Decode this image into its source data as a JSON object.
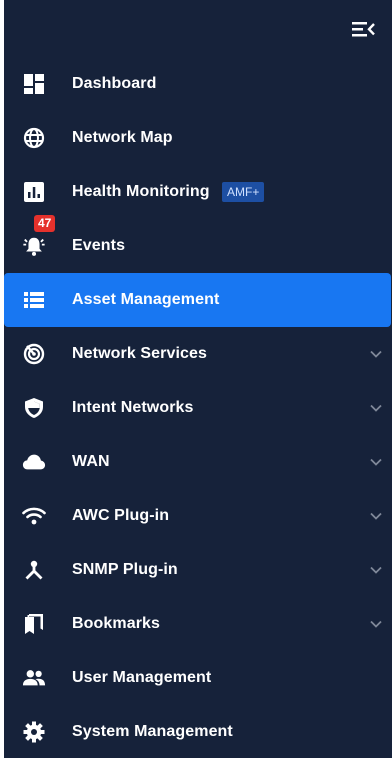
{
  "sidebar": {
    "items": [
      {
        "label": "Dashboard",
        "icon": "dashboard-icon"
      },
      {
        "label": "Network Map",
        "icon": "globe-icon"
      },
      {
        "label": "Health Monitoring",
        "icon": "bar-chart-icon",
        "tag": "AMF+"
      },
      {
        "label": "Events",
        "icon": "bell-alert-icon",
        "badge": "47"
      },
      {
        "label": "Asset Management",
        "icon": "list-icon",
        "active": true
      },
      {
        "label": "Network Services",
        "icon": "radar-icon",
        "expandable": true
      },
      {
        "label": "Intent Networks",
        "icon": "shield-icon",
        "expandable": true
      },
      {
        "label": "WAN",
        "icon": "cloud-icon",
        "expandable": true
      },
      {
        "label": "AWC Plug-in",
        "icon": "wifi-icon",
        "expandable": true
      },
      {
        "label": "SNMP Plug-in",
        "icon": "network-hub-icon",
        "expandable": true
      },
      {
        "label": "Bookmarks",
        "icon": "bookmarks-icon",
        "expandable": true
      },
      {
        "label": "User Management",
        "icon": "users-icon"
      },
      {
        "label": "System Management",
        "icon": "gear-icon"
      }
    ]
  },
  "colors": {
    "sidebar_bg": "#16223a",
    "active_bg": "#1877f2",
    "badge_bg": "#e5312c",
    "tag_bg": "#1d4fa3"
  }
}
